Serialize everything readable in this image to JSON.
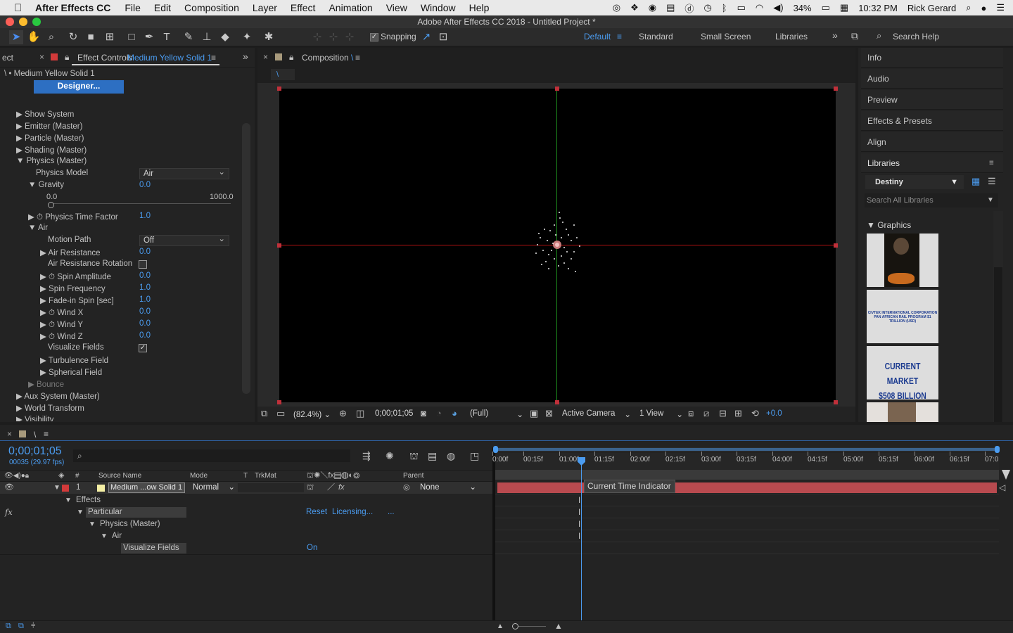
{
  "menubar": {
    "app": "After Effects CC",
    "items": [
      "File",
      "Edit",
      "Composition",
      "Layer",
      "Effect",
      "Animation",
      "View",
      "Window",
      "Help"
    ],
    "battery": "34%",
    "time": "10:32 PM",
    "user": "Rick Gerard"
  },
  "window": {
    "title": "Adobe After Effects CC 2018 - Untitled Project *"
  },
  "toolbar": {
    "snapping": "Snapping",
    "workspaces": [
      "Default",
      "Standard",
      "Small Screen",
      "Libraries"
    ],
    "search_help": "Search Help"
  },
  "effect_controls": {
    "tab_left": "ect",
    "tab": "Effect Controls",
    "tab_layer": "Medium Yellow Solid 1",
    "breadcrumb": "\\ • Medium Yellow Solid 1",
    "designer": "Designer...",
    "props": {
      "show_system": "Show System",
      "emitter": "Emitter (Master)",
      "particle": "Particle (Master)",
      "shading": "Shading (Master)",
      "physics": "Physics (Master)",
      "physics_model": "Physics Model",
      "physics_model_val": "Air",
      "gravity": "Gravity",
      "gravity_val": "0.0",
      "slider_min": "0.0",
      "slider_max": "1000.0",
      "physics_time_factor": "Physics Time Factor",
      "physics_time_factor_val": "1.0",
      "air": "Air",
      "motion_path": "Motion Path",
      "motion_path_val": "Off",
      "air_resistance": "Air Resistance",
      "air_resistance_val": "0.0",
      "air_resistance_rotation": "Air Resistance Rotation",
      "spin_amplitude": "Spin Amplitude",
      "spin_amplitude_val": "0.0",
      "spin_frequency": "Spin Frequency",
      "spin_frequency_val": "1.0",
      "fade_in_spin": "Fade-in Spin [sec]",
      "fade_in_spin_val": "1.0",
      "wind_x": "Wind X",
      "wind_x_val": "0.0",
      "wind_y": "Wind Y",
      "wind_y_val": "0.0",
      "wind_z": "Wind Z",
      "wind_z_val": "0.0",
      "visualize_fields": "Visualize Fields",
      "turbulence_field": "Turbulence Field",
      "spherical_field": "Spherical Field",
      "bounce": "Bounce",
      "aux_system": "Aux System (Master)",
      "world_transform": "World Transform",
      "visibility": "Visibility"
    }
  },
  "composition": {
    "tab": "Composition",
    "tab_name": "\\",
    "subtab": "\\",
    "zoom": "(82.4%)",
    "timecode": "0;00;01;05",
    "resolution": "(Full)",
    "camera": "Active Camera",
    "view": "1 View",
    "exposure": "+0.0"
  },
  "right_panel": {
    "items": [
      "Info",
      "Audio",
      "Preview",
      "Effects & Presets",
      "Align"
    ],
    "libraries": "Libraries",
    "library_name": "Destiny",
    "search_placeholder": "Search All Libraries",
    "graphics": "Graphics",
    "thumb2_line1": "CIVTEK INTERNATIONAL CORPORATION",
    "thumb2_line2": "PAN AFRICAN RAIL PROGRAM $1 TRILLION (USD)",
    "thumb3_line1": "CURRENT MARKET",
    "thumb3_line2": "$508 BILLION"
  },
  "timeline": {
    "tab": "\\",
    "timecode": "0;00;01;05",
    "frames": "00035 (29.97 fps)",
    "col_source": "Source Name",
    "col_mode": "Mode",
    "col_t": "T",
    "col_trkmat": "TrkMat",
    "col_parent": "Parent",
    "col_num": "#",
    "layer_num": "1",
    "layer_name": "Medium ...ow Solid 1",
    "layer_mode": "Normal",
    "layer_parent": "None",
    "effects": "Effects",
    "particular": "Particular",
    "reset": "Reset",
    "licensing": "Licensing...",
    "ellipsis": "...",
    "physics_master": "Physics (Master)",
    "air": "Air",
    "visualize_fields": "Visualize Fields",
    "visualize_val": "On",
    "cti_tooltip": "Current Time Indicator",
    "ruler": [
      "0:00f",
      "00:15f",
      "01:00f",
      "01:15f",
      "02:00f",
      "02:15f",
      "03:00f",
      "03:15f",
      "04:00f",
      "04:15f",
      "05:00f",
      "05:15f",
      "06:00f",
      "06:15f",
      "07:0"
    ]
  },
  "colors": {
    "accent": "#4b9cf0",
    "layer_bar": "#b84a4f",
    "label_red": "#d23a3a",
    "label_yellow": "#f4efa4"
  }
}
